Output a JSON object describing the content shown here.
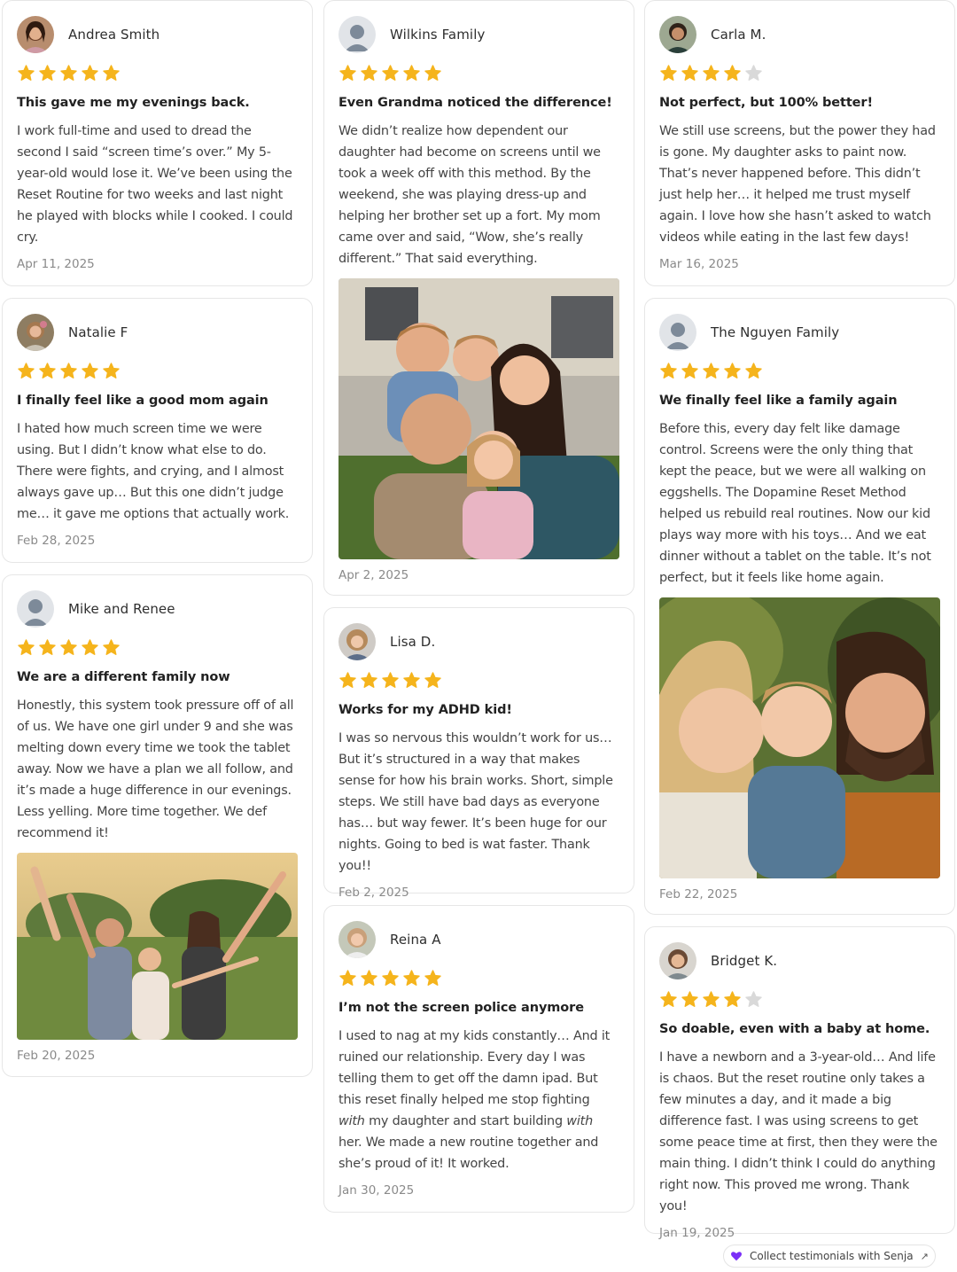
{
  "colors": {
    "star_filled": "#f5b41c",
    "star_empty": "#d9d9d9",
    "accent": "#7b2ff7"
  },
  "reviews": [
    {
      "name": "Andrea Smith",
      "rating": 5,
      "title": "This gave me my evenings back.",
      "body": "I work full-time and used to dread the second I said “screen time’s over.” My 5-year-old would lose it. We’ve been using the Reset Routine for two weeks and last night he played with blocks while I cooked. I could cry.",
      "date": "Apr 11, 2025"
    },
    {
      "name": "Natalie F",
      "rating": 5,
      "title": "I finally feel like a good mom again",
      "body": "I hated how much screen time we were using. But I didn’t know what else to do. There were fights, and crying, and I almost always gave up… But this one didn’t judge me… it gave me options that actually work.",
      "date": "Feb 28, 2025"
    },
    {
      "name": "Mike and Renee",
      "rating": 5,
      "title": "We are a different family now",
      "body": "Honestly, this system took pressure off of all of us. We have one girl under 9 and she was melting down every time we took the tablet away. Now we have a plan we all follow, and it’s made a huge difference in our evenings. Less yelling. More time together. We def recommend it!",
      "date": "Feb 20, 2025"
    },
    {
      "name": "Wilkins Family",
      "rating": 5,
      "title": "Even Grandma noticed the difference!",
      "body": "We didn’t realize how dependent our daughter had become on screens until we took a week off with this method. By the weekend, she was playing dress-up and helping her brother set up a fort. My mom came over and said, “Wow, she’s really different.” That said everything.",
      "date": "Apr 2, 2025"
    },
    {
      "name": "Lisa D.",
      "rating": 5,
      "title": "Works for my ADHD kid!",
      "body": "I was so nervous this wouldn’t work for us… But it’s structured in a way that makes sense for how his brain works. Short, simple steps. We still have bad days as everyone has… but way fewer. It’s been huge for our nights. Going to bed is wat faster. Thank you!!",
      "date": "Feb 2, 2025"
    },
    {
      "name": "Reina A",
      "rating": 5,
      "title": "I’m not the screen police anymore",
      "body_parts": [
        "I used to nag at my kids constantly… And it ruined our relationship. Every day I was telling them to get off the damn ipad. But this reset finally helped me stop fighting ",
        "with",
        " my daughter and start building ",
        "with",
        " her. We made a new routine together and she’s proud of it! It worked."
      ],
      "date": "Jan 30, 2025"
    },
    {
      "name": "Carla M.",
      "rating": 4,
      "title": "Not perfect, but 100% better!",
      "body": "We still use screens, but the power they had is gone. My daughter asks to paint now. That’s never happened before. This didn’t just help her… it helped me trust myself again. I love how she hasn’t asked to watch videos while eating in the last few days!",
      "date": "Mar 16, 2025"
    },
    {
      "name": "The Nguyen Family",
      "rating": 5,
      "title": "We finally feel like a family again",
      "body": "Before this, every day felt like damage control. Screens were the only thing that kept the peace, but we were all walking on eggshells. The Dopamine Reset Method helped us rebuild real routines. Now our kid plays way more with his toys… And we eat dinner without a tablet on the table. It’s not perfect, but it feels like home again.",
      "date": "Feb 22, 2025"
    },
    {
      "name": "Bridget K.",
      "rating": 4,
      "title": "So doable, even with a baby at home.",
      "body": "I have a newborn and a 3-year-old… And life is chaos. But the reset routine only takes a few minutes a day, and it made a big difference fast. I was using screens to get some peace time at first, then they were the main thing. I didn’t think I could do anything right now. This proved me wrong. Thank you!",
      "date": "Jan 19, 2025"
    }
  ],
  "footer": {
    "senja_label": "Collect testimonials with Senja",
    "icons": [
      "heart-icon",
      "external-link-icon"
    ]
  }
}
